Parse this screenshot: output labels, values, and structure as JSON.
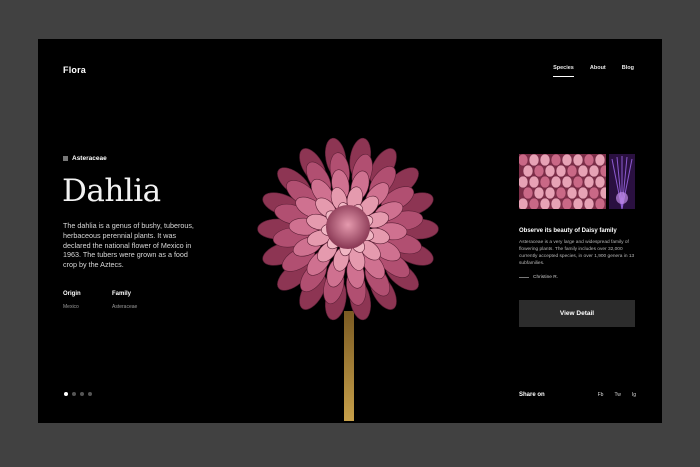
{
  "app": {
    "brand": "Flora"
  },
  "nav": {
    "items": [
      {
        "label": "Species",
        "active": true
      },
      {
        "label": "About"
      },
      {
        "label": "Blog"
      }
    ]
  },
  "hero": {
    "family_tag": "Asteraceae",
    "title": "Dahlia",
    "description": "The dahlia is a genus of bushy, tuberous, herbaceous perennial plants. It was declared the national flower of Mexico in 1963. The tubers were grown as a food crop by the Aztecs.",
    "origin_label": "Origin",
    "origin_value": "Mexico",
    "family_label": "Family",
    "family_value": "Asteraceae"
  },
  "pager": {
    "count": 4,
    "active_index": 1
  },
  "side": {
    "observe_title": "Observe its beauty of Daisy family",
    "observe_text": "Asteraceae is a very large and widespread family of flowering plants. The family includes over 32,000 currently accepted species, in over 1,900 genera in 13 subfamilies.",
    "author": "Christine R.",
    "button_label": "View Detail"
  },
  "share": {
    "label": "Share on",
    "links": [
      "Fb",
      "Tw",
      "Ig"
    ]
  },
  "colors": {
    "background": "#414141",
    "frame": "#000000",
    "accent_pink": "#c56684",
    "button": "#2c2c2c"
  }
}
